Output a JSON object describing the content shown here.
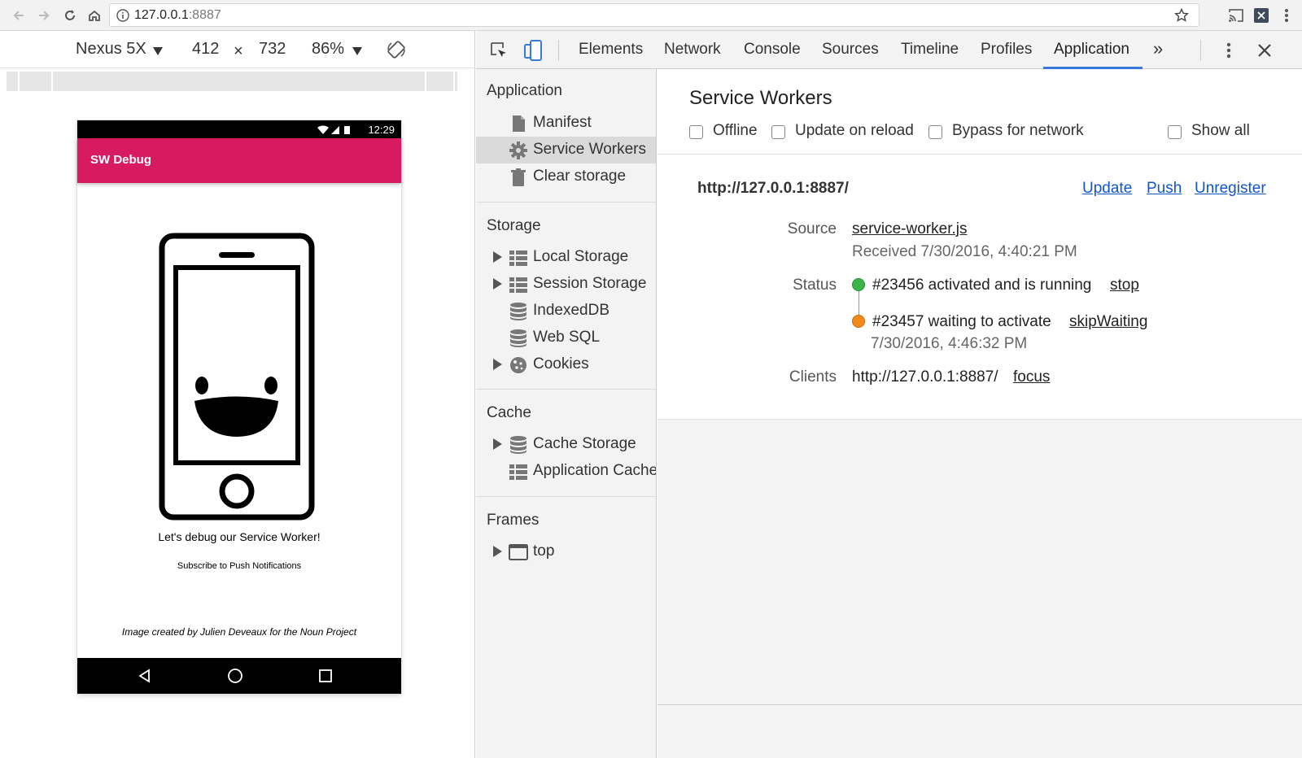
{
  "browser": {
    "url_host": "127.0.0.1",
    "url_port": ":8887"
  },
  "device_toolbar": {
    "device": "Nexus 5X",
    "width": "412",
    "times": "×",
    "height": "732",
    "zoom": "86%"
  },
  "phone": {
    "time": "12:29",
    "app_title": "SW Debug",
    "headline": "Let's debug our Service Worker!",
    "push_button": "Subscribe to Push Notifications",
    "credit": "Image created by Julien Deveaux for the Noun Project"
  },
  "devtools": {
    "tabs": [
      "Elements",
      "Network",
      "Console",
      "Sources",
      "Timeline",
      "Profiles",
      "Application"
    ],
    "active_tab": "Application",
    "more": "»",
    "sidebar": {
      "application_head": "Application",
      "application_items": [
        "Manifest",
        "Service Workers",
        "Clear storage"
      ],
      "storage_head": "Storage",
      "storage_items": [
        "Local Storage",
        "Session Storage",
        "IndexedDB",
        "Web SQL",
        "Cookies"
      ],
      "cache_head": "Cache",
      "cache_items": [
        "Cache Storage",
        "Application Cache"
      ],
      "frames_head": "Frames",
      "frames_items": [
        "top"
      ]
    },
    "main": {
      "title": "Service Workers",
      "options": [
        "Offline",
        "Update on reload",
        "Bypass for network",
        "Show all"
      ],
      "origin": "http://127.0.0.1:8887/",
      "actions": [
        "Update",
        "Push",
        "Unregister"
      ],
      "source_label": "Source",
      "source_file": "service-worker.js",
      "received": "Received 7/30/2016, 4:40:21 PM",
      "status_label": "Status",
      "status_active": "#23456 activated and is running",
      "status_active_action": "stop",
      "status_waiting": "#23457 waiting to activate",
      "status_waiting_action": "skipWaiting",
      "status_waiting_time": "7/30/2016, 4:46:32 PM",
      "clients_label": "Clients",
      "clients_url": "http://127.0.0.1:8887/",
      "clients_action": "focus"
    }
  },
  "colors": {
    "app_bar": "#d81b60",
    "tab_accent": "#3879d9",
    "running_dot": "#3bb54a",
    "waiting_dot": "#f2891b",
    "link": "#1155cc"
  }
}
